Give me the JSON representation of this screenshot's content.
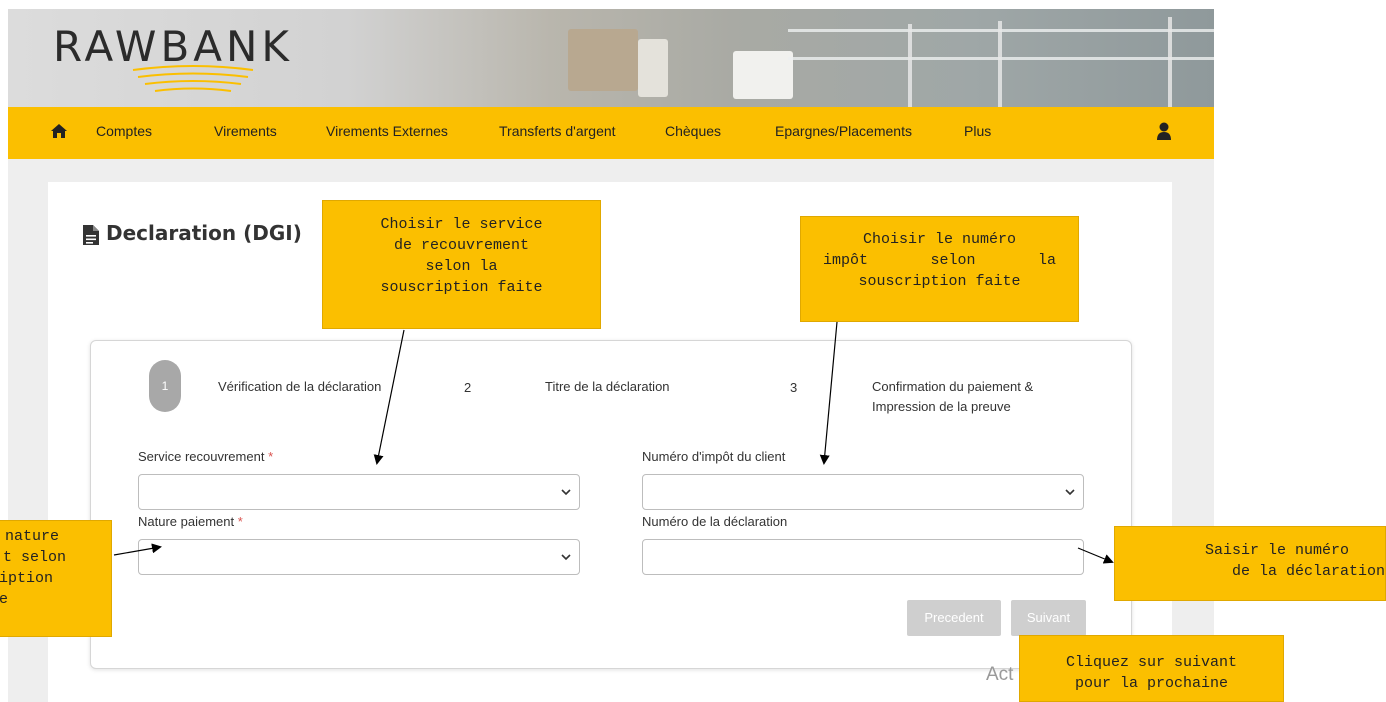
{
  "header": {
    "logo": "RAWBANK"
  },
  "nav": {
    "home_icon": "home-icon",
    "items": [
      {
        "label": "Comptes"
      },
      {
        "label": "Virements"
      },
      {
        "label": "Virements Externes"
      },
      {
        "label": "Transferts d'argent"
      },
      {
        "label": "Chèques"
      },
      {
        "label": "Epargnes/Placements"
      },
      {
        "label": "Plus"
      }
    ],
    "user_icon": "user-icon"
  },
  "page": {
    "title": "Declaration (DGI)",
    "title_icon": "document-icon"
  },
  "steps": [
    {
      "number": "1",
      "label": "Vérification de la déclaration",
      "active": true
    },
    {
      "number": "2",
      "label": "Titre de la déclaration"
    },
    {
      "number": "3",
      "label_line1": "Confirmation du paiement &",
      "label_line2": "Impression de la preuve"
    }
  ],
  "form": {
    "service_label": "Service recouvrement",
    "required_mark": "*",
    "service_value": "",
    "impot_label": "Numéro d'impôt du client",
    "impot_value": "",
    "nature_label": "Nature paiement",
    "nature_value": "",
    "declaration_label": "Numéro de la déclaration",
    "declaration_value": ""
  },
  "buttons": {
    "precedent": "Precedent",
    "suivant": "Suivant"
  },
  "callouts": {
    "service": [
      "Choisir le service",
      "de recouvrement",
      "selon la",
      "souscription faite"
    ],
    "impot": [
      "Choisir le numéro",
      "impôt selon la",
      "souscription faite"
    ],
    "nature": [
      "nature",
      "t selon",
      "iption",
      "e"
    ],
    "declaration": [
      "Saisir le numéro",
      "de la déclaration"
    ],
    "suivant": [
      "Cliquez sur suivant",
      "pour la prochaine"
    ]
  },
  "watermark": "Act",
  "colors": {
    "brand_yellow": "#fbbf00",
    "button_disabled": "#cfcfcf",
    "required": "#d9534f"
  }
}
